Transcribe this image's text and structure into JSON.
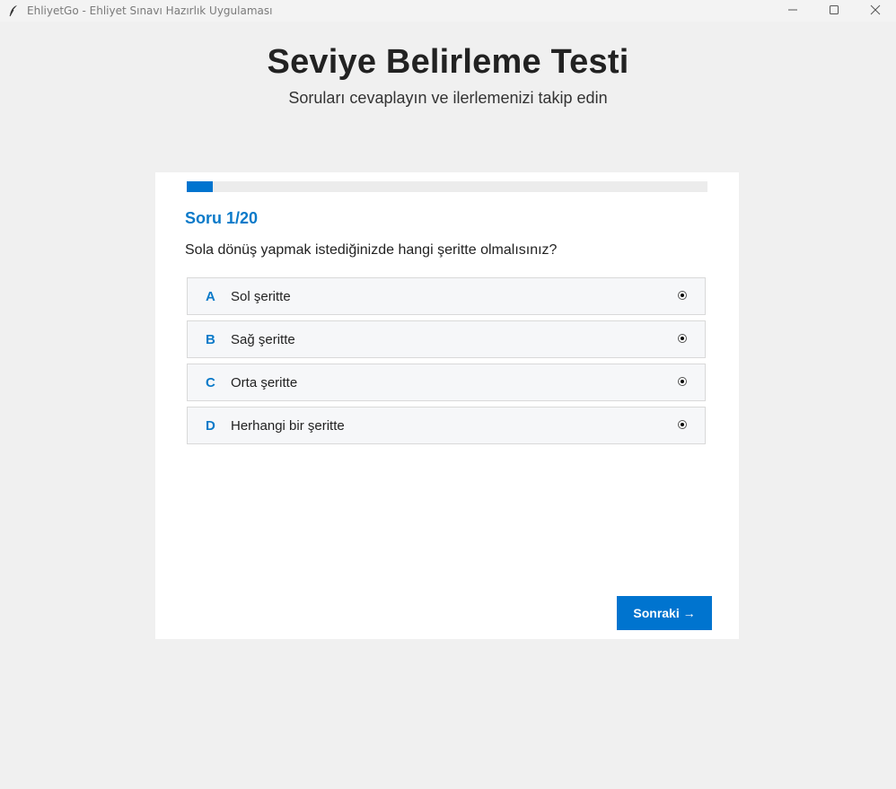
{
  "window": {
    "title": "EhliyetGo - Ehliyet Sınavı Hazırlık Uygulaması",
    "icons": [
      "feather-icon",
      "minimize-icon",
      "maximize-icon",
      "close-icon"
    ]
  },
  "header": {
    "title": "Seviye Belirleme Testi",
    "subtitle": "Soruları cevaplayın ve ilerlemenizi takip edin"
  },
  "quiz": {
    "progress": 0.05,
    "question_label": "Soru 1/20",
    "question_text": "Sola dönüş yapmak istediğinizde hangi şeritte olmalısınız?",
    "options": [
      {
        "letter": "A",
        "text": "Sol şeritte"
      },
      {
        "letter": "B",
        "text": "Sağ şeritte"
      },
      {
        "letter": "C",
        "text": "Orta şeritte"
      },
      {
        "letter": "D",
        "text": "Herhangi bir şeritte"
      }
    ],
    "next_label": "Sonraki →"
  },
  "colors": {
    "accent": "#0074cf",
    "accent_text": "#0a7ac9",
    "background": "#f0f0f0",
    "card": "#ffffff",
    "option_bg": "#f6f7f9"
  }
}
